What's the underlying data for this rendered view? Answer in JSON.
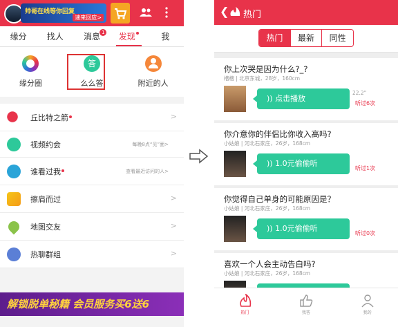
{
  "left": {
    "banner": {
      "text": "帅哥在线等你回复",
      "cta": "速来回应>"
    },
    "tabs": [
      {
        "label": "缘分",
        "active": false
      },
      {
        "label": "找人",
        "active": false
      },
      {
        "label": "消息",
        "active": false,
        "badge": "1"
      },
      {
        "label": "发现",
        "active": true,
        "dot": true
      },
      {
        "label": "我",
        "active": false
      }
    ],
    "features": [
      {
        "label": "缘分圈",
        "icon": "ring-icon"
      },
      {
        "label": "么么答",
        "icon": "answer-icon"
      },
      {
        "label": "附近的人",
        "icon": "nearby-person-icon"
      }
    ],
    "list": [
      {
        "label": "丘比特之箭",
        "dot": true,
        "right": "",
        "icon": "cupid-icon"
      },
      {
        "label": "视频约会",
        "dot": false,
        "right": "每晚8点“见”面>",
        "icon": "video-icon"
      },
      {
        "label": "谁看过我",
        "dot": true,
        "right": "查看最近访问的人>",
        "icon": "eye-icon"
      },
      {
        "label": "擦肩而过",
        "dot": false,
        "right": "",
        "icon": "brush-icon"
      },
      {
        "label": "地图交友",
        "dot": false,
        "right": "",
        "icon": "map-pin-icon"
      },
      {
        "label": "热聊群组",
        "dot": false,
        "right": "",
        "icon": "group-chat-icon"
      }
    ],
    "bottom_banner": "解锁脱单秘籍 会员服务买6送6"
  },
  "right": {
    "title": "热门",
    "segments": [
      {
        "label": "热门",
        "active": true
      },
      {
        "label": "最新",
        "active": false
      },
      {
        "label": "同性",
        "active": false
      }
    ],
    "cards": [
      {
        "question": "你上次哭是因为什么?_?",
        "meta": "楷楷 | 北京东城，28岁，160cm",
        "button": "点击播放",
        "duration": "22.2\"",
        "heard": "听过6次"
      },
      {
        "question": "你介意你的伴侣比你收入高吗?",
        "meta": "小姑娘 | 河北石家庄，26岁，168cm",
        "button": "1.0元偷偷听",
        "duration": "",
        "heard": "听过1次"
      },
      {
        "question": "你觉得自己单身的可能原因是？",
        "meta": "小姑娘 | 河北石家庄，26岁，168cm",
        "button": "1.0元偷偷听",
        "duration": "",
        "heard": "听过0次"
      },
      {
        "question": "喜欢一个人会主动告白吗?",
        "meta": "小姑娘 | 河北石家庄，26岁，168cm",
        "button": "",
        "duration": "",
        "heard": ""
      }
    ],
    "nav": [
      {
        "label": "热门",
        "active": true
      },
      {
        "label": "我答",
        "active": false
      },
      {
        "label": "我的",
        "active": false
      }
    ]
  },
  "colors": {
    "brand": "#e8334a",
    "accent": "#2dc99a"
  }
}
